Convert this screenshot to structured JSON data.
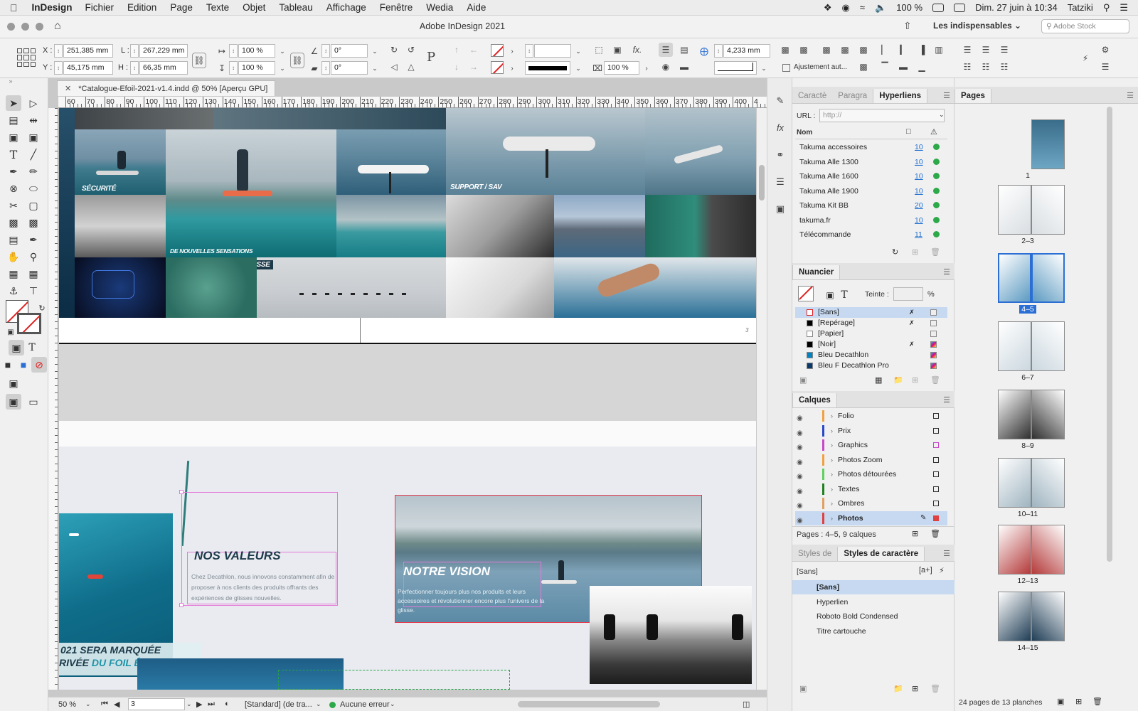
{
  "menubar": {
    "app": "InDesign",
    "items": [
      "Fichier",
      "Edition",
      "Page",
      "Texte",
      "Objet",
      "Tableau",
      "Affichage",
      "Fenêtre",
      "Wedia",
      "Aide"
    ],
    "battery": "100 %",
    "datetime": "Dim. 27 juin à 10:34",
    "user": "Tatziki"
  },
  "titlebar": {
    "title": "Adobe InDesign 2021",
    "workspace": "Les indispensables",
    "stock_placeholder": "Adobe Stock"
  },
  "control": {
    "x_label": "X :",
    "x": "251,385 mm",
    "y_label": "Y :",
    "y": "45,175 mm",
    "w_label": "L :",
    "w": "267,229 mm",
    "h_label": "H :",
    "h": "66,35 mm",
    "scale_x": "100 %",
    "scale_y": "100 %",
    "rotate": "0°",
    "shear": "0°",
    "stroke_pct": "100 %",
    "gap": "4,233 mm",
    "auto_fit": "Ajustement aut..."
  },
  "document": {
    "tab_title": "*Catalogue-Efoil-2021-v1.4.indd @ 50% [Aperçu GPU]",
    "ruler_h": [
      "60",
      "70",
      "80",
      "90",
      "100",
      "110",
      "120",
      "130",
      "140",
      "150",
      "160",
      "170",
      "180",
      "190",
      "200",
      "210",
      "220",
      "230",
      "240",
      "250",
      "260",
      "270",
      "280",
      "290",
      "300",
      "310",
      "320",
      "330",
      "340",
      "350",
      "360",
      "370",
      "380",
      "390",
      "400",
      "4"
    ],
    "spread1_labels": {
      "securite": "SÉCURITÉ",
      "support": "SUPPORT / SAV",
      "sensations": "DE NOUVELLES SENSATIONS",
      "glisse": "DE GLISSE"
    },
    "page_number": "3",
    "valeurs_title": "NOS VALEURS",
    "valeurs_body": "Chez Decathlon, nous innovons constamment afin de proposer à nos clients des produits offrants des expériences de glisses nouvelles.",
    "vision_title": "NOTRE VISION",
    "vision_body": "Perfectionner toujours plus nos produits et leurs accessoires et révolutionner encore plus l'univers de la glisse.",
    "tagline1": "021 SERA MARQUÉE",
    "tagline2a": "RIVÉE ",
    "tagline2b": "DU FOIL ÉLECTRIQUE !"
  },
  "status": {
    "zoom": "50 %",
    "page": "3",
    "style": "[Standard] (de tra...",
    "errors": "Aucune erreur"
  },
  "hyperlinks": {
    "tabs": [
      "Caractè",
      "Paragra",
      "Hyperliens"
    ],
    "url_label": "URL :",
    "url_placeholder": "http://",
    "col_name": "Nom",
    "items": [
      {
        "name": "Takuma accessoires",
        "page": "10"
      },
      {
        "name": "Takuma Alle 1300",
        "page": "10"
      },
      {
        "name": "Takuma Alle 1600",
        "page": "10"
      },
      {
        "name": "Takuma Alle 1900",
        "page": "10"
      },
      {
        "name": "Takuma Kit BB",
        "page": "20"
      },
      {
        "name": "takuma.fr",
        "page": "10"
      },
      {
        "name": "Télécommande",
        "page": "11"
      }
    ]
  },
  "swatches": {
    "title": "Nuancier",
    "tint_label": "Teinte :",
    "pct": "%",
    "items": [
      {
        "name": "[Sans]",
        "color": "#ffffff"
      },
      {
        "name": "[Repérage]",
        "color": "#000000"
      },
      {
        "name": "[Papier]",
        "color": "#ffffff"
      },
      {
        "name": "[Noir]",
        "color": "#000000"
      },
      {
        "name": "Bleu Decathlon",
        "color": "#0082c3"
      },
      {
        "name": "Bleu F Decathlon Pro",
        "color": "#0a3a6b"
      }
    ]
  },
  "layers": {
    "title": "Calques",
    "items": [
      {
        "name": "Folio",
        "color": "#f0a040"
      },
      {
        "name": "Prix",
        "color": "#2848c8"
      },
      {
        "name": "Graphics",
        "color": "#c848c8"
      },
      {
        "name": "Photos Zoom",
        "color": "#f0a040"
      },
      {
        "name": "Photos détourées",
        "color": "#60d060"
      },
      {
        "name": "Textes",
        "color": "#208020"
      },
      {
        "name": "Ombres",
        "color": "#e0a060"
      },
      {
        "name": "Photos",
        "color": "#e04040"
      }
    ],
    "footer": "Pages : 4–5, 9 calques"
  },
  "charstyles": {
    "tabs": [
      "Styles de",
      "Styles de caractère"
    ],
    "current": "[Sans]",
    "items": [
      "[Sans]",
      "Hyperlien",
      "Roboto Bold Condensed",
      "Titre cartouche"
    ]
  },
  "pages": {
    "title": "Pages",
    "labels": [
      "1",
      "2–3",
      "4–5",
      "6–7",
      "8–9",
      "10–11",
      "12–13",
      "14–15"
    ],
    "footer": "24 pages de 13 planches"
  }
}
